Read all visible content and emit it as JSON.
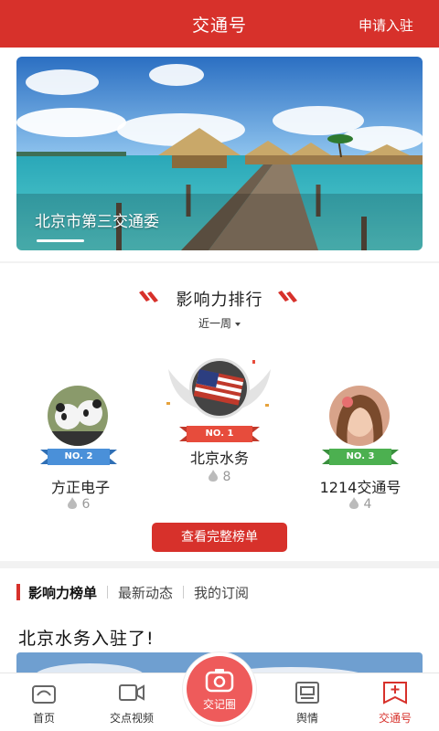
{
  "header": {
    "title": "交通号",
    "action": "申请入驻"
  },
  "banner": {
    "caption": "北京市第三交通委"
  },
  "ranking": {
    "title": "影响力排行",
    "period": "近一周",
    "first": {
      "badge": "NO. 1",
      "name": "北京水务",
      "count": "8"
    },
    "second": {
      "badge": "NO. 2",
      "name": "方正电子",
      "count": "6"
    },
    "third": {
      "badge": "NO. 3",
      "name": "1214交通号",
      "count": "4"
    },
    "full_list_button": "查看完整榜单"
  },
  "tabs": [
    "影响力榜单",
    "最新动态",
    "我的订阅"
  ],
  "article": {
    "title": "北京水务入驻了!"
  },
  "bottom_nav": [
    {
      "label": "首页",
      "icon": "home-icon"
    },
    {
      "label": "交点视频",
      "icon": "video-icon"
    },
    {
      "label": "交记圈",
      "icon": "camera-icon"
    },
    {
      "label": "舆情",
      "icon": "news-icon"
    },
    {
      "label": "交通号",
      "icon": "plus-square-icon"
    }
  ],
  "colors": {
    "accent": "#d7312b",
    "gold": "#e74c3c",
    "silver": "#4a90d9",
    "bronze": "#4cb050"
  }
}
